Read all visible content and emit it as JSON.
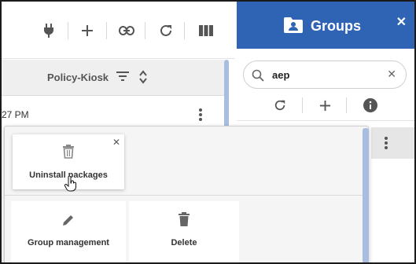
{
  "toolbar": {
    "icons": [
      "plug-icon",
      "plus-icon",
      "link-icon",
      "refresh-icon",
      "columns-icon"
    ]
  },
  "table": {
    "column_header": "Policy-Kiosk",
    "row_time": "27 PM"
  },
  "groups_panel": {
    "title": "Groups",
    "close_label": "✕",
    "search": {
      "value": "aep",
      "clear_label": "✕"
    }
  },
  "popup": {
    "uninstall_label": "Uninstall packages",
    "close_label": "✕",
    "group_management_label": "Group management",
    "delete_label": "Delete"
  },
  "colors": {
    "header_blue": "#2f63b3",
    "scroll_accent": "#a8bde0"
  }
}
